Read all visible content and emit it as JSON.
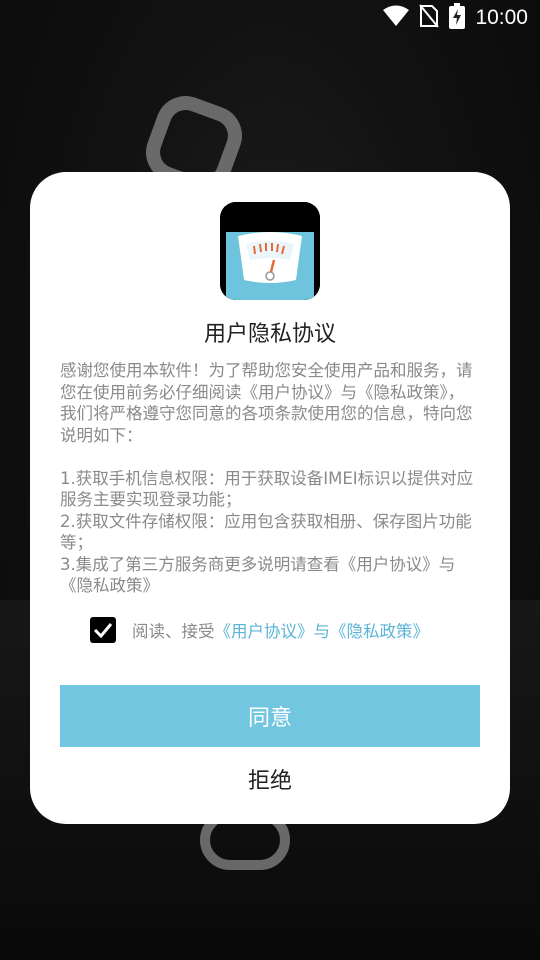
{
  "status_bar": {
    "time": "10:00",
    "icons": [
      "wifi-icon",
      "no-sim-icon",
      "battery-charging-icon"
    ]
  },
  "dialog": {
    "title": "用户隐私协议",
    "body": "感谢您使用本软件！为了帮助您安全使用产品和服务，请您在使用前务必仔细阅读《用户协议》与《隐私政策》，我们将严格遵守您同意的各项条款使用您的信息，特向您说明如下：\n\n1.获取手机信息权限：用于获取设备IMEI标识以提供对应服务主要实现登录功能；\n2.获取文件存储权限：应用包含获取相册、保存图片功能等；\n3.集成了第三方服务商更多说明请查看《用户协议》与《隐私政策》",
    "agree_checkbox": {
      "checked": true,
      "label": "阅读、接受",
      "link_text": "《用户协议》与《隐私政策》"
    },
    "agree_button_label": "同意",
    "refuse_button_label": "拒绝"
  },
  "colors": {
    "accent": "#72c6df",
    "link": "#5ab4d6",
    "body_text": "#8a8a8a"
  }
}
